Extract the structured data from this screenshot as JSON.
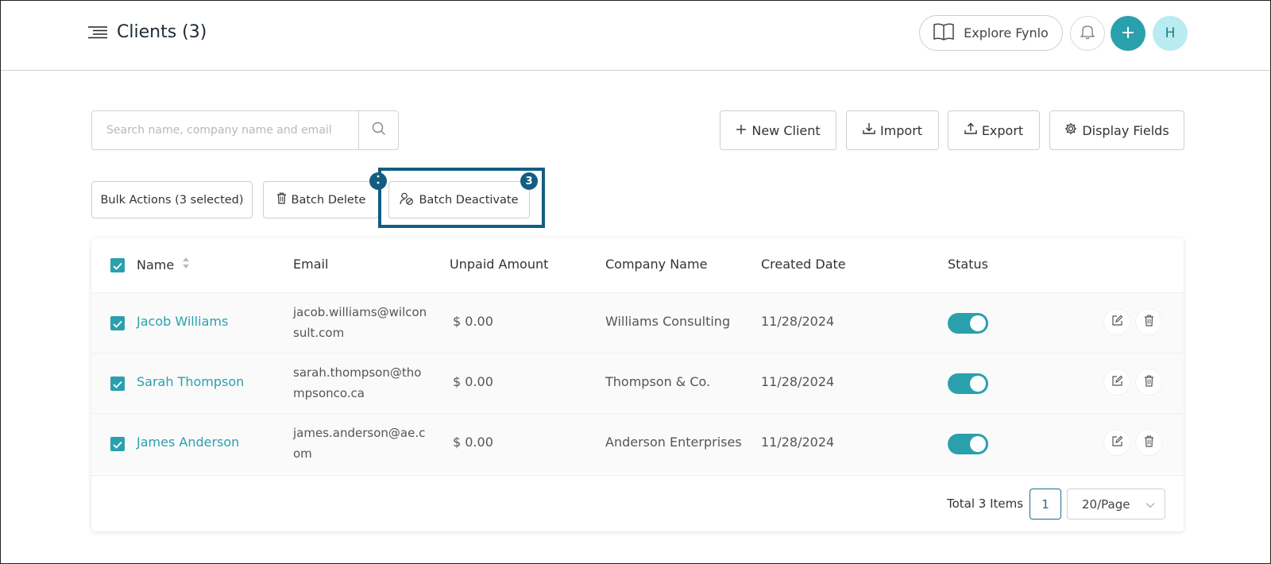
{
  "header": {
    "title": "Clients (3)",
    "explore_label": "Explore Fynlo",
    "avatar_initial": "H"
  },
  "toolbar": {
    "search_placeholder": "Search name, company name and email",
    "new_client_label": "New Client",
    "import_label": "Import",
    "export_label": "Export",
    "display_fields_label": "Display Fields"
  },
  "bulk": {
    "bulk_actions_label": "Bulk Actions (3 selected)",
    "batch_delete_label": "Batch Delete",
    "batch_deactivate_label": "Batch Deactivate",
    "deactivate_badge": "3"
  },
  "table": {
    "headers": {
      "name": "Name",
      "email": "Email",
      "unpaid": "Unpaid Amount",
      "company": "Company Name",
      "created": "Created Date",
      "status": "Status"
    },
    "rows": [
      {
        "name": "Jacob Williams",
        "email": "jacob.williams@wilconsult.com",
        "unpaid": "$ 0.00",
        "company": "Williams Consulting",
        "created": "11/28/2024",
        "active": true,
        "selected": true
      },
      {
        "name": "Sarah Thompson",
        "email": "sarah.thompson@thompsonco.ca",
        "unpaid": "$ 0.00",
        "company": "Thompson & Co.",
        "created": "11/28/2024",
        "active": true,
        "selected": true
      },
      {
        "name": "James Anderson",
        "email": "james.anderson@ae.com",
        "unpaid": "$ 0.00",
        "company": "Anderson Enterprises",
        "created": "11/28/2024",
        "active": true,
        "selected": true
      }
    ]
  },
  "pagination": {
    "total_label": "Total 3 Items",
    "current_page": "1",
    "page_size": "20/Page"
  },
  "colors": {
    "accent": "#2aa0ad",
    "highlight": "#145d82"
  }
}
